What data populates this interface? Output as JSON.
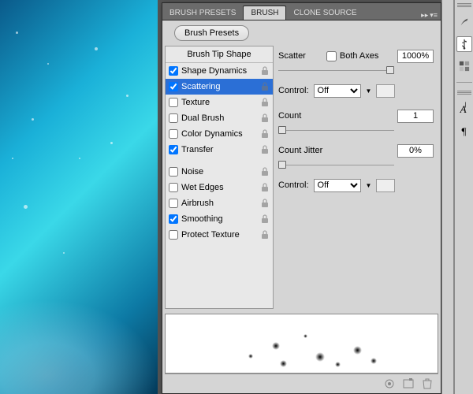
{
  "tabs": {
    "presets": "BRUSH PRESETS",
    "brush": "BRUSH",
    "clone": "CLONE SOURCE"
  },
  "buttons": {
    "brush_presets": "Brush Presets"
  },
  "list": {
    "header": "Brush Tip Shape",
    "items": [
      {
        "label": "Shape Dynamics",
        "checked": true,
        "lock": true
      },
      {
        "label": "Scattering",
        "checked": true,
        "lock": true,
        "selected": true
      },
      {
        "label": "Texture",
        "checked": false,
        "lock": true
      },
      {
        "label": "Dual Brush",
        "checked": false,
        "lock": true
      },
      {
        "label": "Color Dynamics",
        "checked": false,
        "lock": true
      },
      {
        "label": "Transfer",
        "checked": true,
        "lock": true
      }
    ],
    "items2": [
      {
        "label": "Noise",
        "checked": false,
        "lock": true
      },
      {
        "label": "Wet Edges",
        "checked": false,
        "lock": true
      },
      {
        "label": "Airbrush",
        "checked": false,
        "lock": true
      },
      {
        "label": "Smoothing",
        "checked": true,
        "lock": true
      },
      {
        "label": "Protect Texture",
        "checked": false,
        "lock": true
      }
    ]
  },
  "controls": {
    "scatter_label": "Scatter",
    "both_axes_label": "Both Axes",
    "both_axes_checked": false,
    "scatter_value": "1000%",
    "control_label": "Control:",
    "control1_value": "Off",
    "count_label": "Count",
    "count_value": "1",
    "count_jitter_label": "Count Jitter",
    "count_jitter_value": "0%",
    "control2_value": "Off"
  },
  "dock": {
    "items": [
      "brush-icon",
      "usb-icon",
      "swatches-icon"
    ],
    "items2": [
      "text-icon",
      "paragraph-icon"
    ]
  }
}
